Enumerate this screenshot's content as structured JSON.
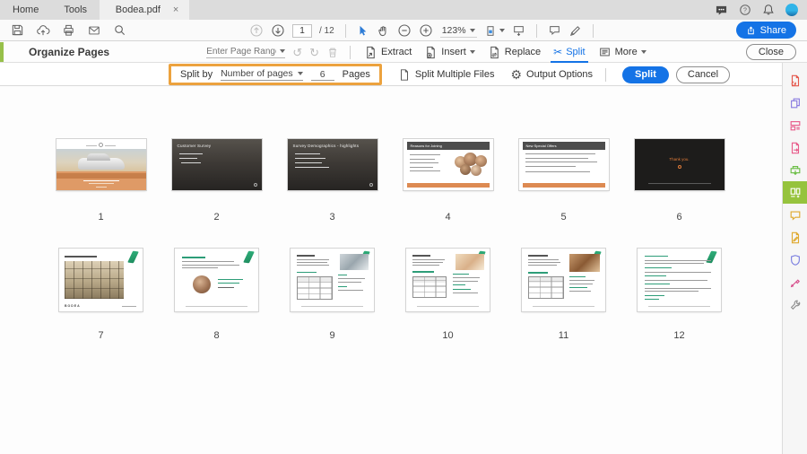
{
  "tabs": {
    "home": "Home",
    "tools": "Tools",
    "document": "Bodea.pdf",
    "close_glyph": "×"
  },
  "toolbar": {
    "page_current": "1",
    "page_total": "/ 12",
    "zoom_level": "123%",
    "share_label": "Share"
  },
  "organize_bar": {
    "title": "Organize Pages",
    "page_range_placeholder": "Enter Page Range",
    "extract_label": "Extract",
    "insert_label": "Insert",
    "replace_label": "Replace",
    "split_label": "Split",
    "more_label": "More",
    "close_label": "Close"
  },
  "split_bar": {
    "split_by_label": "Split by",
    "split_mode_value": "Number of pages",
    "pages_value": "6",
    "pages_label": "Pages",
    "split_multiple_label": "Split Multiple Files",
    "output_options_label": "Output Options",
    "split_button_label": "Split",
    "cancel_button_label": "Cancel"
  },
  "glyphs": {
    "undo": "↺",
    "redo": "↻",
    "scissors": "✂",
    "gear": "⚙"
  },
  "pages": [
    {
      "number": "1",
      "title": ""
    },
    {
      "number": "2",
      "title": "Customer Survey"
    },
    {
      "number": "3",
      "title": "Survey Demographics - highlights"
    },
    {
      "number": "4",
      "title": "Reasons for Joining"
    },
    {
      "number": "5",
      "title": "New Special Offers"
    },
    {
      "number": "6",
      "title": "Thank you."
    },
    {
      "number": "7",
      "title": "",
      "brand": "BODEA"
    },
    {
      "number": "8",
      "title": ""
    },
    {
      "number": "9",
      "title": ""
    },
    {
      "number": "10",
      "title": ""
    },
    {
      "number": "11",
      "title": ""
    },
    {
      "number": "12",
      "title": ""
    }
  ],
  "sidebar_tools": [
    {
      "icon": "create-pdf-icon",
      "color": "#e4584c",
      "selected": false
    },
    {
      "icon": "combine-files-icon",
      "color": "#8a7ce0",
      "selected": false
    },
    {
      "icon": "edit-pdf-icon",
      "color": "#e85b8a",
      "selected": false
    },
    {
      "icon": "export-pdf-icon",
      "color": "#e85b8a",
      "selected": false
    },
    {
      "icon": "scan-ocr-icon",
      "color": "#6bbe45",
      "selected": false
    },
    {
      "icon": "organize-pages-icon",
      "color": "#ffffff",
      "selected": true
    },
    {
      "icon": "comment-icon",
      "color": "#dfa92f",
      "selected": false
    },
    {
      "icon": "fill-sign-icon",
      "color": "#dfa92f",
      "selected": false
    },
    {
      "icon": "protect-icon",
      "color": "#7b7fe0",
      "selected": false
    },
    {
      "icon": "certificates-pen-icon",
      "color": "#d64c8a",
      "selected": false
    },
    {
      "icon": "more-tools-icon",
      "color": "#8e8e8e",
      "selected": false
    }
  ],
  "colors": {
    "accent_blue": "#1473e6",
    "tool_green": "#97c04a",
    "highlight_orange": "#eca23e",
    "selected_tool_bg": "#96c33d"
  }
}
